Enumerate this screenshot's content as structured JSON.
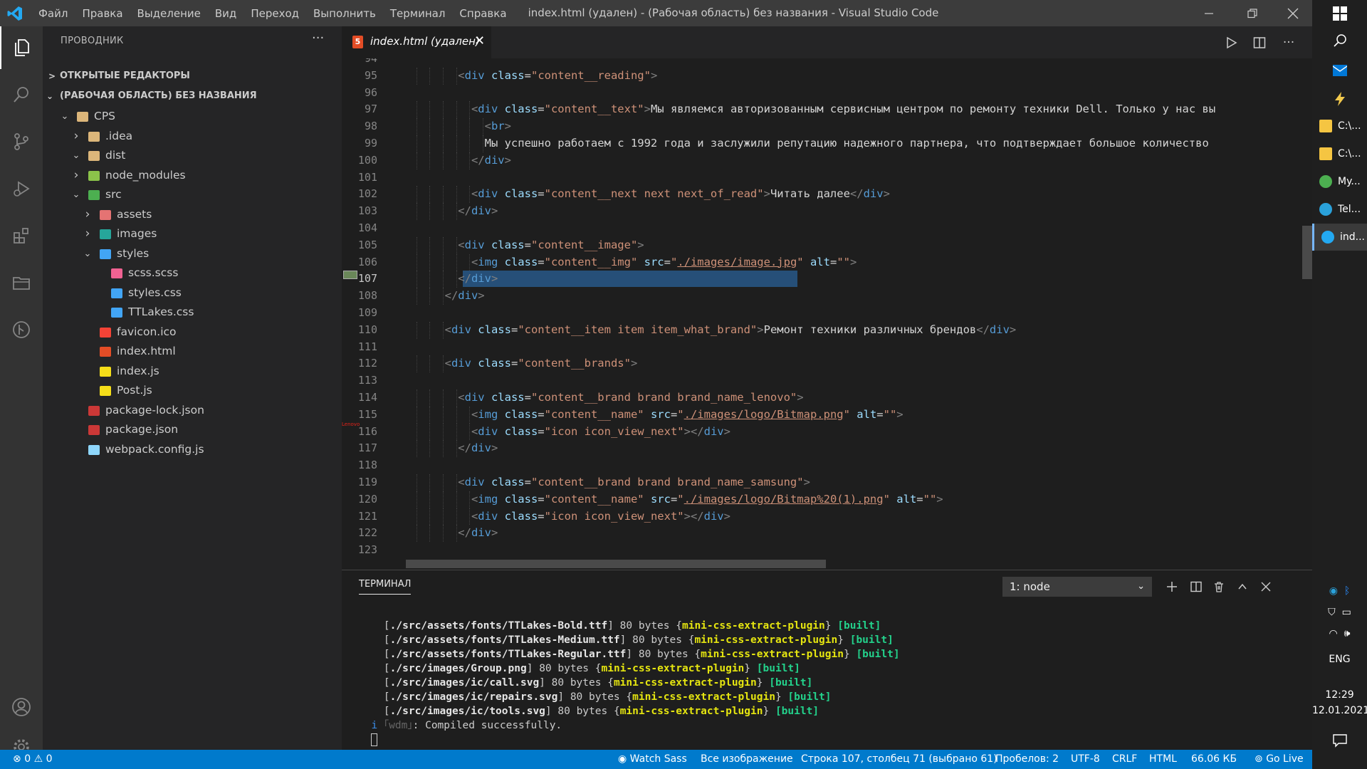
{
  "window": {
    "title": "index.html (удален) - (Рабочая область) без названия - Visual Studio Code",
    "menu": [
      "Файл",
      "Правка",
      "Выделение",
      "Вид",
      "Переход",
      "Выполнить",
      "Терминал",
      "Справка"
    ]
  },
  "sidebar": {
    "title": "ПРОВОДНИК",
    "more": "···",
    "section_open": "ОТКРЫТЫЕ РЕДАКТОРЫ",
    "section_workspace": "(РАБОЧАЯ ОБЛАСТЬ) БЕЗ НАЗВАНИЯ",
    "tree": [
      {
        "label": "CPS",
        "depth": 1,
        "twisty": "open",
        "icon": "folder-icon",
        "color": "#dcb67a"
      },
      {
        "label": ".idea",
        "depth": 2,
        "twisty": "closed",
        "icon": "folder-idea-icon",
        "color": "#dcb67a"
      },
      {
        "label": "dist",
        "depth": 2,
        "twisty": "open",
        "icon": "folder-dist-icon",
        "color": "#dcb67a"
      },
      {
        "label": "node_modules",
        "depth": 2,
        "twisty": "closed",
        "icon": "folder-node-icon",
        "color": "#8bc34a"
      },
      {
        "label": "src",
        "depth": 2,
        "twisty": "open",
        "icon": "folder-src-icon",
        "color": "#4caf50"
      },
      {
        "label": "assets",
        "depth": 3,
        "twisty": "closed",
        "icon": "folder-assets-icon",
        "color": "#e57373"
      },
      {
        "label": "images",
        "depth": 3,
        "twisty": "closed",
        "icon": "folder-images-icon",
        "color": "#26a69a"
      },
      {
        "label": "styles",
        "depth": 3,
        "twisty": "open",
        "icon": "folder-styles-icon",
        "color": "#42a5f5"
      },
      {
        "label": "scss.scss",
        "depth": 4,
        "twisty": "",
        "icon": "sass-file-icon",
        "color": "#f06292"
      },
      {
        "label": "styles.css",
        "depth": 4,
        "twisty": "",
        "icon": "css-file-icon",
        "color": "#42a5f5"
      },
      {
        "label": "TTLakes.css",
        "depth": 4,
        "twisty": "",
        "icon": "css-file-icon",
        "color": "#42a5f5"
      },
      {
        "label": "favicon.ico",
        "depth": 3,
        "twisty": "",
        "icon": "favicon-file-icon",
        "color": "#f44336"
      },
      {
        "label": "index.html",
        "depth": 3,
        "twisty": "",
        "icon": "html-file-icon",
        "color": "#e44d26"
      },
      {
        "label": "index.js",
        "depth": 3,
        "twisty": "",
        "icon": "js-file-icon",
        "color": "#f5de19"
      },
      {
        "label": "Post.js",
        "depth": 3,
        "twisty": "",
        "icon": "js-file-icon",
        "color": "#f5de19"
      },
      {
        "label": "package-lock.json",
        "depth": 2,
        "twisty": "",
        "icon": "npm-file-icon",
        "color": "#cb3837"
      },
      {
        "label": "package.json",
        "depth": 2,
        "twisty": "",
        "icon": "npm-file-icon",
        "color": "#cb3837"
      },
      {
        "label": "webpack.config.js",
        "depth": 2,
        "twisty": "",
        "icon": "webpack-file-icon",
        "color": "#8ed6fb"
      }
    ]
  },
  "editor": {
    "tab_label": "index.html (удален)",
    "tab_icon": "5",
    "tab_close": "✕",
    "first_line": 95,
    "current_line": 107,
    "lines": [
      [
        {
          "t": "",
          "c": "txt"
        }
      ],
      [
        {
          "t": "<",
          "c": "br"
        },
        {
          "t": "div",
          "c": "tag"
        },
        {
          "t": " class",
          "c": "attr"
        },
        {
          "t": "=",
          "c": "txt"
        },
        {
          "t": "\"content__reading\"",
          "c": "str"
        },
        {
          "t": ">",
          "c": "br"
        }
      ],
      [
        {
          "t": "",
          "c": "txt"
        }
      ],
      [
        {
          "t": "<",
          "c": "br"
        },
        {
          "t": "div",
          "c": "tag"
        },
        {
          "t": " class",
          "c": "attr"
        },
        {
          "t": "=",
          "c": "txt"
        },
        {
          "t": "\"content__text\"",
          "c": "str"
        },
        {
          "t": ">",
          "c": "br"
        },
        {
          "t": "Мы являемся авторизованным сервисным центром по ремонту техники Dell. Только у нас вы",
          "c": "txt"
        }
      ],
      [
        {
          "t": "<",
          "c": "br"
        },
        {
          "t": "br",
          "c": "tag"
        },
        {
          "t": ">",
          "c": "br"
        }
      ],
      [
        {
          "t": "Мы успешно работаем с 1992 года и заслужили репутацию надежного партнера, что подтверждает большое количество",
          "c": "txt"
        }
      ],
      [
        {
          "t": "</",
          "c": "br"
        },
        {
          "t": "div",
          "c": "tag"
        },
        {
          "t": ">",
          "c": "br"
        }
      ],
      [
        {
          "t": "",
          "c": "txt"
        }
      ],
      [
        {
          "t": "<",
          "c": "br"
        },
        {
          "t": "div",
          "c": "tag"
        },
        {
          "t": " class",
          "c": "attr"
        },
        {
          "t": "=",
          "c": "txt"
        },
        {
          "t": "\"content__next next next_of_read\"",
          "c": "str"
        },
        {
          "t": ">",
          "c": "br"
        },
        {
          "t": "Читать далее",
          "c": "txt"
        },
        {
          "t": "</",
          "c": "br"
        },
        {
          "t": "div",
          "c": "tag"
        },
        {
          "t": ">",
          "c": "br"
        }
      ],
      [
        {
          "t": "</",
          "c": "br"
        },
        {
          "t": "div",
          "c": "tag"
        },
        {
          "t": ">",
          "c": "br"
        }
      ],
      [
        {
          "t": "",
          "c": "txt"
        }
      ],
      [
        {
          "t": "<",
          "c": "br"
        },
        {
          "t": "div",
          "c": "tag"
        },
        {
          "t": " class",
          "c": "attr"
        },
        {
          "t": "=",
          "c": "txt"
        },
        {
          "t": "\"content__image\"",
          "c": "str"
        },
        {
          "t": ">",
          "c": "br"
        }
      ],
      [
        {
          "t": "<",
          "c": "br"
        },
        {
          "t": "img",
          "c": "tag"
        },
        {
          "t": " class",
          "c": "attr"
        },
        {
          "t": "=",
          "c": "txt"
        },
        {
          "t": "\"content__img\"",
          "c": "str"
        },
        {
          "t": " src",
          "c": "attr"
        },
        {
          "t": "=",
          "c": "txt"
        },
        {
          "t": "\"",
          "c": "str"
        },
        {
          "t": "./images/image.jpg",
          "c": "url"
        },
        {
          "t": "\"",
          "c": "str"
        },
        {
          "t": " alt",
          "c": "attr"
        },
        {
          "t": "=",
          "c": "txt"
        },
        {
          "t": "\"\"",
          "c": "str"
        },
        {
          "t": ">",
          "c": "br"
        }
      ],
      [
        {
          "t": "</",
          "c": "br"
        },
        {
          "t": "div",
          "c": "tag"
        },
        {
          "t": ">",
          "c": "br"
        }
      ],
      [
        {
          "t": "</",
          "c": "br"
        },
        {
          "t": "div",
          "c": "tag"
        },
        {
          "t": ">",
          "c": "br"
        }
      ],
      [
        {
          "t": "",
          "c": "txt"
        }
      ],
      [
        {
          "t": "<",
          "c": "br"
        },
        {
          "t": "div",
          "c": "tag"
        },
        {
          "t": " class",
          "c": "attr"
        },
        {
          "t": "=",
          "c": "txt"
        },
        {
          "t": "\"content__item item item_what_brand\"",
          "c": "str"
        },
        {
          "t": ">",
          "c": "br"
        },
        {
          "t": "Ремонт техники различных брендов",
          "c": "txt"
        },
        {
          "t": "</",
          "c": "br"
        },
        {
          "t": "div",
          "c": "tag"
        },
        {
          "t": ">",
          "c": "br"
        }
      ],
      [
        {
          "t": "",
          "c": "txt"
        }
      ],
      [
        {
          "t": "<",
          "c": "br"
        },
        {
          "t": "div",
          "c": "tag"
        },
        {
          "t": " class",
          "c": "attr"
        },
        {
          "t": "=",
          "c": "txt"
        },
        {
          "t": "\"content__brands\"",
          "c": "str"
        },
        {
          "t": ">",
          "c": "br"
        }
      ],
      [
        {
          "t": "",
          "c": "txt"
        }
      ],
      [
        {
          "t": "<",
          "c": "br"
        },
        {
          "t": "div",
          "c": "tag"
        },
        {
          "t": " class",
          "c": "attr"
        },
        {
          "t": "=",
          "c": "txt"
        },
        {
          "t": "\"content__brand brand brand_name_lenovo\"",
          "c": "str"
        },
        {
          "t": ">",
          "c": "br"
        }
      ],
      [
        {
          "t": "<",
          "c": "br"
        },
        {
          "t": "img",
          "c": "tag"
        },
        {
          "t": " class",
          "c": "attr"
        },
        {
          "t": "=",
          "c": "txt"
        },
        {
          "t": "\"content__name\"",
          "c": "str"
        },
        {
          "t": " src",
          "c": "attr"
        },
        {
          "t": "=",
          "c": "txt"
        },
        {
          "t": "\"",
          "c": "str"
        },
        {
          "t": "./images/logo/Bitmap.png",
          "c": "url"
        },
        {
          "t": "\"",
          "c": "str"
        },
        {
          "t": " alt",
          "c": "attr"
        },
        {
          "t": "=",
          "c": "txt"
        },
        {
          "t": "\"\"",
          "c": "str"
        },
        {
          "t": ">",
          "c": "br"
        }
      ],
      [
        {
          "t": "<",
          "c": "br"
        },
        {
          "t": "div",
          "c": "tag"
        },
        {
          "t": " class",
          "c": "attr"
        },
        {
          "t": "=",
          "c": "txt"
        },
        {
          "t": "\"icon icon_view_next\"",
          "c": "str"
        },
        {
          "t": "></",
          "c": "br"
        },
        {
          "t": "div",
          "c": "tag"
        },
        {
          "t": ">",
          "c": "br"
        }
      ],
      [
        {
          "t": "</",
          "c": "br"
        },
        {
          "t": "div",
          "c": "tag"
        },
        {
          "t": ">",
          "c": "br"
        }
      ],
      [
        {
          "t": "",
          "c": "txt"
        }
      ],
      [
        {
          "t": "<",
          "c": "br"
        },
        {
          "t": "div",
          "c": "tag"
        },
        {
          "t": " class",
          "c": "attr"
        },
        {
          "t": "=",
          "c": "txt"
        },
        {
          "t": "\"content__brand brand brand_name_samsung\"",
          "c": "str"
        },
        {
          "t": ">",
          "c": "br"
        }
      ],
      [
        {
          "t": "<",
          "c": "br"
        },
        {
          "t": "img",
          "c": "tag"
        },
        {
          "t": " class",
          "c": "attr"
        },
        {
          "t": "=",
          "c": "txt"
        },
        {
          "t": "\"content__name\"",
          "c": "str"
        },
        {
          "t": " src",
          "c": "attr"
        },
        {
          "t": "=",
          "c": "txt"
        },
        {
          "t": "\"",
          "c": "str"
        },
        {
          "t": "./images/logo/Bitmap%20(1).png",
          "c": "url"
        },
        {
          "t": "\"",
          "c": "str"
        },
        {
          "t": " alt",
          "c": "attr"
        },
        {
          "t": "=",
          "c": "txt"
        },
        {
          "t": "\"\"",
          "c": "str"
        },
        {
          "t": ">",
          "c": "br"
        }
      ],
      [
        {
          "t": "<",
          "c": "br"
        },
        {
          "t": "div",
          "c": "tag"
        },
        {
          "t": " class",
          "c": "attr"
        },
        {
          "t": "=",
          "c": "txt"
        },
        {
          "t": "\"icon icon_view_next\"",
          "c": "str"
        },
        {
          "t": "></",
          "c": "br"
        },
        {
          "t": "div",
          "c": "tag"
        },
        {
          "t": ">",
          "c": "br"
        }
      ],
      [
        {
          "t": "</",
          "c": "br"
        },
        {
          "t": "div",
          "c": "tag"
        },
        {
          "t": ">",
          "c": "br"
        }
      ],
      [
        {
          "t": "",
          "c": "txt"
        }
      ]
    ],
    "indent": [
      0,
      5,
      0,
      6,
      7,
      7,
      6,
      0,
      6,
      5,
      0,
      5,
      6,
      5,
      4,
      0,
      4,
      0,
      4,
      0,
      5,
      6,
      6,
      5,
      0,
      5,
      6,
      6,
      5,
      0
    ],
    "lenovo_mark": "Lenovo"
  },
  "panel": {
    "title": "ТЕРМИНАЛ",
    "terminal_select": "1: node",
    "lines": [
      {
        "path": "./src/assets/fonts/TTLakes-Bold.ttf",
        "size": "80 bytes",
        "plugin": "mini-css-extract-plugin",
        "state": "[built]"
      },
      {
        "path": "./src/assets/fonts/TTLakes-Medium.ttf",
        "size": "80 bytes",
        "plugin": "mini-css-extract-plugin",
        "state": "[built]"
      },
      {
        "path": "./src/assets/fonts/TTLakes-Regular.ttf",
        "size": "80 bytes",
        "plugin": "mini-css-extract-plugin",
        "state": "[built]"
      },
      {
        "path": "./src/images/Group.png",
        "size": "80 bytes",
        "plugin": "mini-css-extract-plugin",
        "state": "[built]"
      },
      {
        "path": "./src/images/ic/call.svg",
        "size": "80 bytes",
        "plugin": "mini-css-extract-plugin",
        "state": "[built]"
      },
      {
        "path": "./src/images/ic/repairs.svg",
        "size": "80 bytes",
        "plugin": "mini-css-extract-plugin",
        "state": "[built]"
      },
      {
        "path": "./src/images/ic/tools.svg",
        "size": "80 bytes",
        "plugin": "mini-css-extract-plugin",
        "state": "[built]"
      }
    ],
    "compiled_prefix": "i",
    "compiled_wdm": "｢wdm｣",
    "compiled_text": ": Compiled successfully."
  },
  "status": {
    "errors": "0",
    "warnings": "0",
    "watch_sass": "Watch Sass",
    "all_images": "Все изображение",
    "position": "Строка 107, столбец 71 (выбрано 61)",
    "spaces": "Пробелов: 2",
    "encoding": "UTF-8",
    "eol": "CRLF",
    "language": "HTML",
    "size": "66.06 КБ",
    "go_live": "Go Live"
  },
  "taskbar": {
    "items": [
      {
        "label": "C:\\...",
        "icon": "folder-icon",
        "color": "#f5c542"
      },
      {
        "label": "C:\\...",
        "icon": "folder-icon",
        "color": "#f5c542"
      },
      {
        "label": "My...",
        "icon": "chrome-icon",
        "color": "#4caf50"
      },
      {
        "label": "Tel...",
        "icon": "telegram-icon",
        "color": "#2aa1da"
      },
      {
        "label": "ind...",
        "icon": "vscode-icon",
        "color": "#23a9f2"
      }
    ],
    "lang": "ENG",
    "time": "12:29",
    "date": "12.01.2021"
  },
  "colors": {
    "accent": "#007acc",
    "titlebar": "#3c3c3c",
    "sidebar": "#252526",
    "editor_bg": "#1e1e1e",
    "selection": "#264f78"
  }
}
